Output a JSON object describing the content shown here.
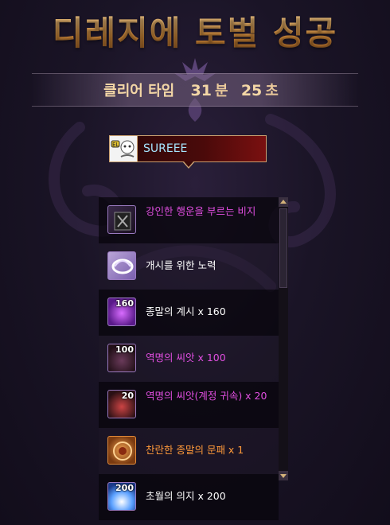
{
  "title": "디레지에 토벌 성공",
  "clear_time": {
    "label": "클리어 타임",
    "minutes": "31",
    "minutes_unit": "분",
    "seconds": "25",
    "seconds_unit": "초"
  },
  "player": {
    "name": "SUREEE",
    "avatar_icon": "character-portrait-icon"
  },
  "rewards": [
    {
      "name": "강인한 행운을 부르는 비지",
      "qty": "",
      "color": "#e04ee0",
      "icon": "charm-item-icon"
    },
    {
      "name": "개시를 위한 노력",
      "qty": "",
      "color": "#ffffff",
      "icon": "swirl-item-icon"
    },
    {
      "name": "종말의 계시 x 160",
      "qty": "160",
      "color": "#ffffff",
      "icon": "purple-orb-item-icon"
    },
    {
      "name": "역명의 씨앗 x 100",
      "qty": "100",
      "color": "#e04ee0",
      "icon": "seed-item-icon"
    },
    {
      "name": "역명의 씨앗(계정 귀속) x 20",
      "qty": "20",
      "color": "#e04ee0",
      "icon": "bound-seed-item-icon"
    },
    {
      "name": "찬란한 종말의 문패 x 1",
      "qty": "",
      "color": "#ff9a3a",
      "icon": "plaque-item-icon"
    },
    {
      "name": "초월의 의지 x 200",
      "qty": "200",
      "color": "#ffffff",
      "icon": "blue-crystal-item-icon"
    }
  ]
}
